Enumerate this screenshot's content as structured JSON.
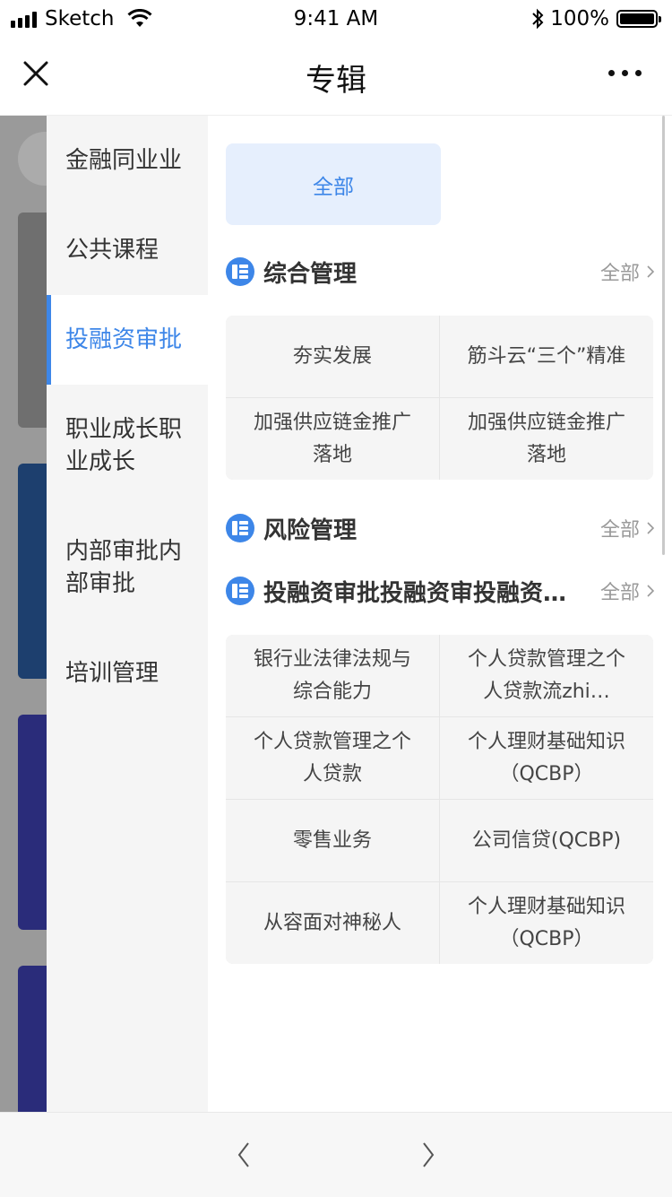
{
  "status_bar": {
    "carrier": "Sketch",
    "time": "9:41 AM",
    "battery": "100%"
  },
  "navbar": {
    "title": "专辑"
  },
  "categories": [
    {
      "label": "金融同业业",
      "active": false
    },
    {
      "label": "公共课程",
      "active": false
    },
    {
      "label": "投融资审批",
      "active": true
    },
    {
      "label": "职业成长职业成长",
      "active": false
    },
    {
      "label": "内部审批内部审批",
      "active": false
    },
    {
      "label": "培训管理",
      "active": false
    }
  ],
  "all_chip": "全部",
  "sections": [
    {
      "title": "综合管理",
      "all_label": "全部",
      "items": [
        "夯实发展",
        "筋斗云“三个”精准",
        "加强供应链金推广落地",
        "加强供应链金推广落地"
      ]
    },
    {
      "title": "风险管理",
      "all_label": "全部",
      "items": []
    },
    {
      "title": "投融资审批投融资审投融资审批",
      "all_label": "全部",
      "items": [
        "银行业法律法规与综合能力",
        "个人贷款管理之个人贷款流zhi…",
        "个人贷款管理之个人贷款",
        "个人理财基础知识（QCBP）",
        "零售业务",
        "公司信贷(QCBP)",
        "从容面对神秘人",
        "个人理财基础知识（QCBP）"
      ]
    }
  ],
  "accent_color": "#3d86e8"
}
